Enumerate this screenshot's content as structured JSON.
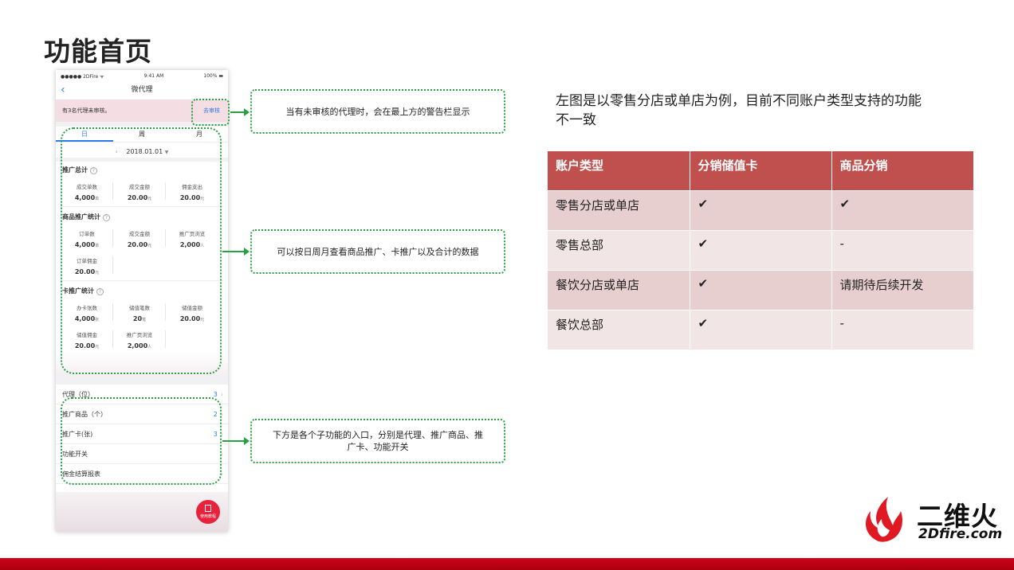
{
  "page": {
    "title": "功能首页"
  },
  "phone": {
    "status": {
      "carrier": "●●●●● 2DFire ᯤ",
      "time": "9:41 AM",
      "battery": "100% ▬"
    },
    "nav_title": "微代理",
    "alert_text": "有3名代理未审核。",
    "alert_link": "去审核",
    "tabs": [
      "日",
      "周",
      "月"
    ],
    "date_value": "2018.01.01",
    "sections": {
      "total": {
        "title": "推广总计",
        "items": [
          {
            "label": "成交单数",
            "value": "4,000",
            "unit": "单"
          },
          {
            "label": "成交金额",
            "value": "20.00",
            "unit": "元"
          },
          {
            "label": "佣金支出",
            "value": "20.00",
            "unit": "元"
          }
        ]
      },
      "goods": {
        "title": "商品推广统计",
        "items": [
          {
            "label": "订单数",
            "value": "4,000",
            "unit": "单"
          },
          {
            "label": "成交金额",
            "value": "20.00",
            "unit": "元"
          },
          {
            "label": "推广页浏览",
            "value": "2,000",
            "unit": "人"
          },
          {
            "label": "订单佣金",
            "value": "20.00",
            "unit": "元"
          }
        ]
      },
      "card": {
        "title": "卡推广统计",
        "items": [
          {
            "label": "办卡张数",
            "value": "4,000",
            "unit": "张"
          },
          {
            "label": "储值笔数",
            "value": "20",
            "unit": "笔"
          },
          {
            "label": "储值金额",
            "value": "20.00",
            "unit": "元"
          },
          {
            "label": "储值佣金",
            "value": "20.00",
            "unit": "元"
          },
          {
            "label": "推广页浏览",
            "value": "2,000",
            "unit": "人"
          }
        ]
      }
    },
    "menu": [
      {
        "label": "代理（位）",
        "count": "3"
      },
      {
        "label": "推广商品（个）",
        "count": "2"
      },
      {
        "label": "推广卡(张)",
        "count": "3"
      },
      {
        "label": "功能开关",
        "count": ""
      },
      {
        "label": "佣金结算报表",
        "count": ""
      }
    ],
    "fab_label": "使用教程"
  },
  "callouts": {
    "alert": "当有未审核的代理时，会在最上方的警告栏显示",
    "stats": "可以按日周月查看商品推广、卡推广以及合计的数据",
    "menu": "下方是各个子功能的入口，分别是代理、推广商品、推广卡、功能开关"
  },
  "description": "左图是以零售分店或单店为例，目前不同账户类型支持的功能不一致",
  "table": {
    "headers": [
      "账户类型",
      "分销储值卡",
      "商品分销"
    ],
    "rows": [
      [
        "零售分店或单店",
        "✔",
        "✔"
      ],
      [
        "零售总部",
        "✔",
        "-"
      ],
      [
        "餐饮分店或单店",
        "✔",
        "请期待后续开发"
      ],
      [
        "餐饮总部",
        "✔",
        "-"
      ]
    ]
  },
  "logo": {
    "cn": "二维火",
    "en": "2Dfire.com"
  },
  "colors": {
    "accent_red": "#c0504d",
    "callout_green": "#2aa043",
    "link_blue": "#2b7ce9"
  }
}
